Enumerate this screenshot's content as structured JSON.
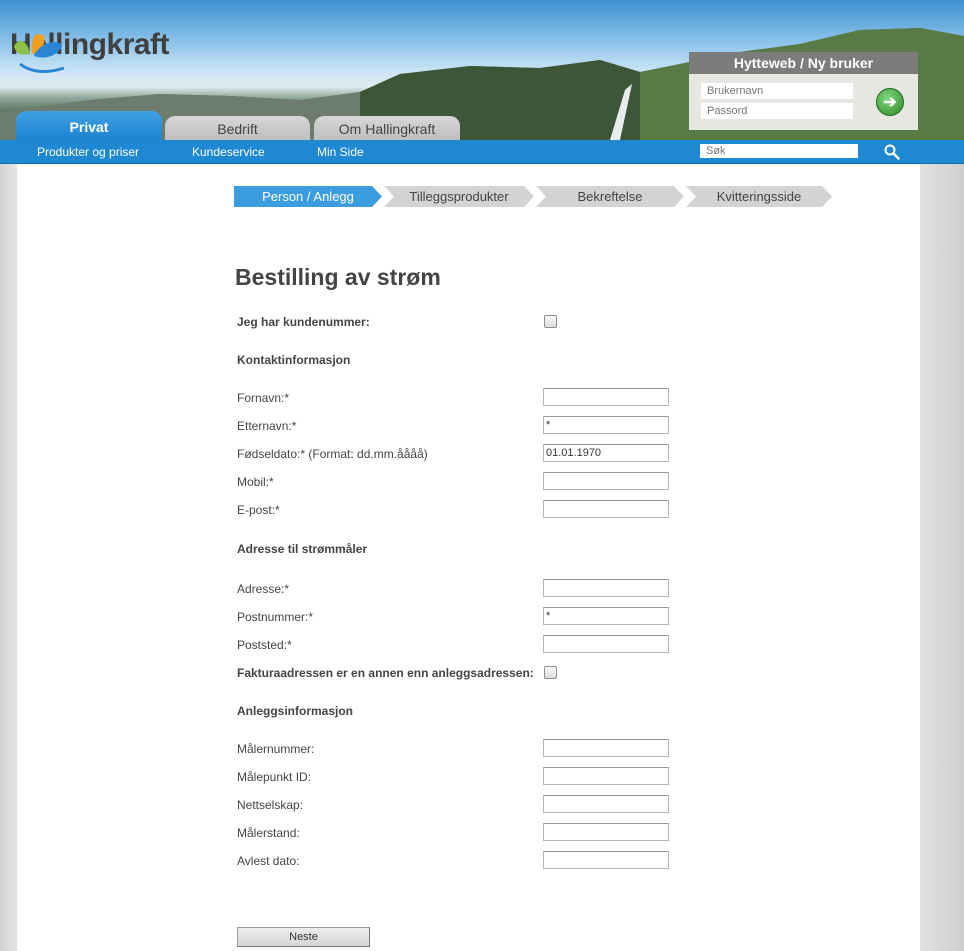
{
  "brand": {
    "name": "Hallingkraft"
  },
  "login": {
    "title": "Hytteweb / Ny bruker",
    "username_placeholder": "Brukernavn",
    "password_placeholder": "Passord"
  },
  "tabs": [
    {
      "label": "Privat",
      "active": true
    },
    {
      "label": "Bedrift",
      "active": false
    },
    {
      "label": "Om Hallingkraft",
      "active": false
    }
  ],
  "nav": {
    "links": [
      "Produkter og priser",
      "Kundeservice",
      "Min Side"
    ],
    "search_placeholder": "Søk"
  },
  "steps": [
    {
      "label": "Person / Anlegg",
      "active": true
    },
    {
      "label": "Tilleggsprodukter",
      "active": false
    },
    {
      "label": "Bekreftelse",
      "active": false
    },
    {
      "label": "Kvitteringsside",
      "active": false
    }
  ],
  "form": {
    "title": "Bestilling av strøm",
    "has_customer_number_label": "Jeg har kundenummer:",
    "contact": {
      "heading": "Kontaktinformasjon",
      "fields": [
        {
          "label": "Fornavn:*",
          "value": ""
        },
        {
          "label": "Etternavn:*",
          "value": "*"
        },
        {
          "label": "Fødseldato:* (Format: dd.mm.åååå)",
          "value": "01.01.1970"
        },
        {
          "label": "Mobil:*",
          "value": ""
        },
        {
          "label": "E-post:*",
          "value": ""
        }
      ]
    },
    "address": {
      "heading": "Adresse til strømmåler",
      "fields": [
        {
          "label": "Adresse:*",
          "value": ""
        },
        {
          "label": "Postnummer:*",
          "value": "*"
        },
        {
          "label": "Poststed:*",
          "value": ""
        }
      ],
      "billing_label": "Fakturaadressen er en annen enn anleggsadressen:"
    },
    "facility": {
      "heading": "Anleggsinformasjon",
      "fields": [
        {
          "label": "Målernummer:",
          "value": ""
        },
        {
          "label": "Målepunkt ID:",
          "value": ""
        },
        {
          "label": "Nettselskap:",
          "value": ""
        },
        {
          "label": "Målerstand:",
          "value": ""
        },
        {
          "label": "Avlest dato:",
          "value": ""
        }
      ]
    },
    "next_label": "Neste"
  },
  "colors": {
    "accent": "#1f88d2",
    "step_active": "#3b9ce0",
    "step_inactive": "#d3d3d3"
  }
}
